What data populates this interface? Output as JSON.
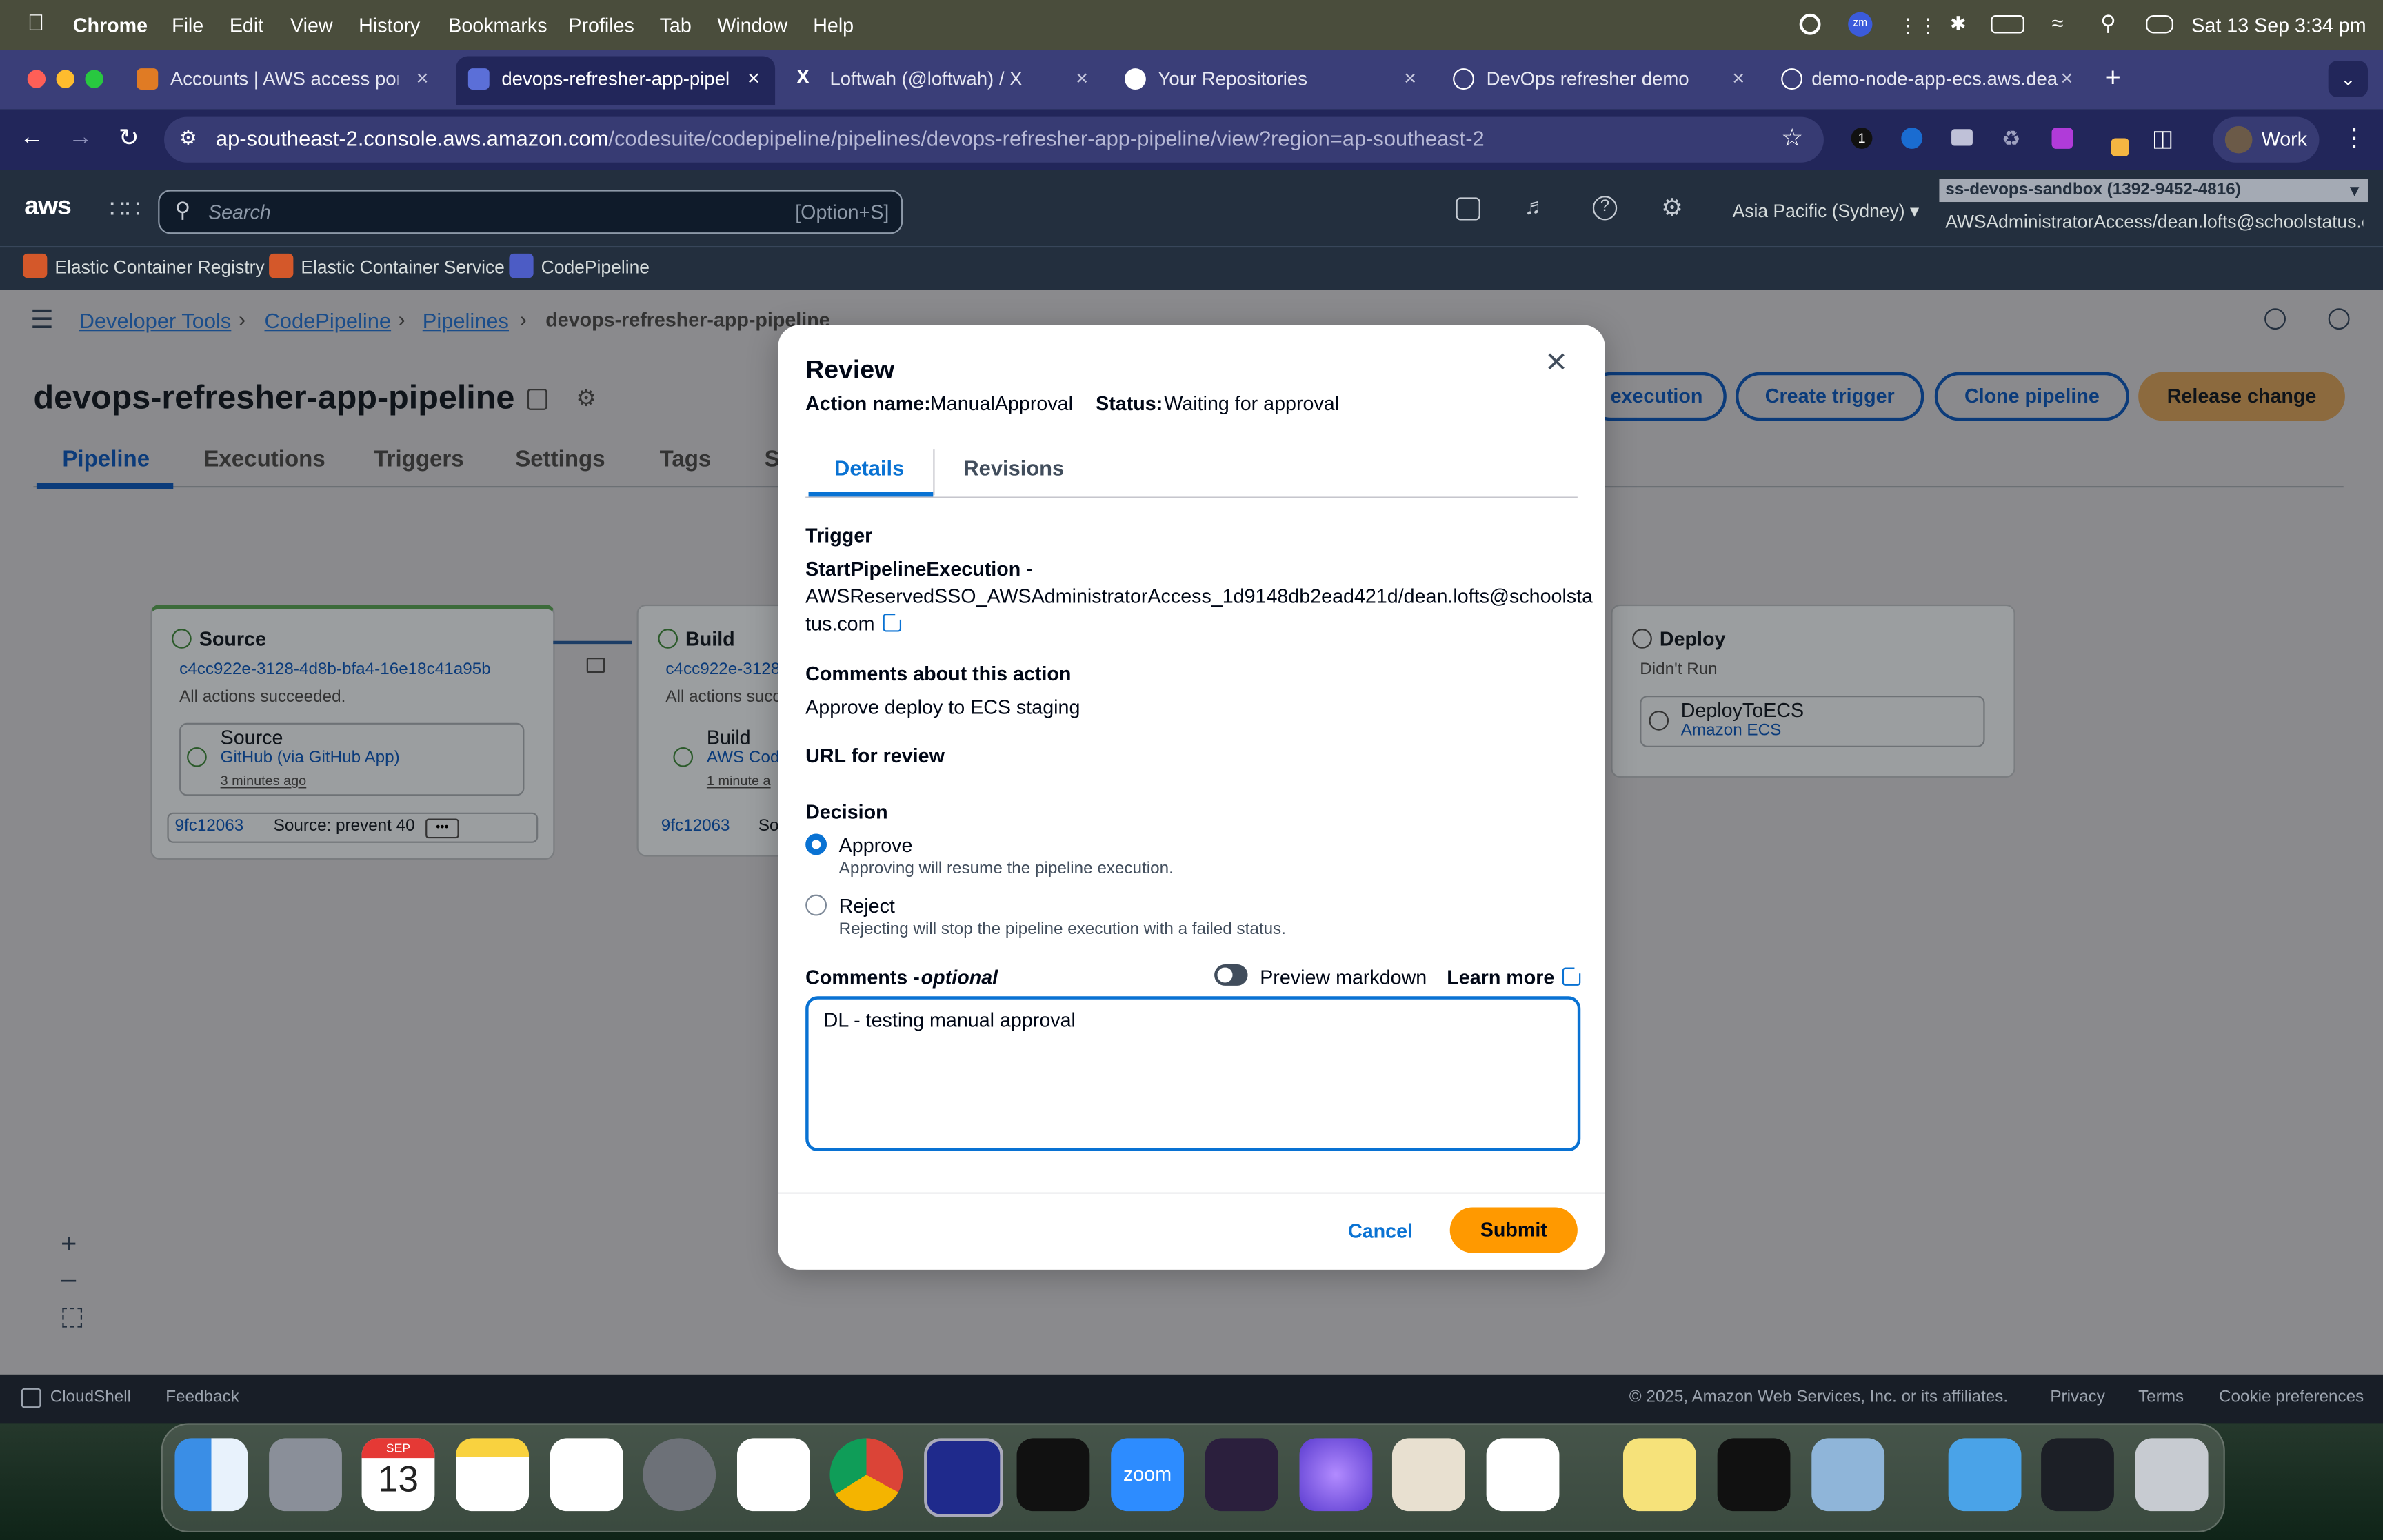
{
  "menubar": {
    "app": "Chrome",
    "items": [
      "File",
      "Edit",
      "View",
      "History",
      "Bookmarks",
      "Profiles",
      "Tab",
      "Window",
      "Help"
    ],
    "datetime": "Sat 13 Sep  3:34 pm"
  },
  "tabs": [
    {
      "title": "Accounts | AWS access porta"
    },
    {
      "title": "devops-refresher-app-pipelin"
    },
    {
      "title": "Loftwah (@loftwah) / X"
    },
    {
      "title": "Your Repositories"
    },
    {
      "title": "DevOps refresher demo"
    },
    {
      "title": "demo-node-app-ecs.aws.dea"
    }
  ],
  "address": {
    "host": "ap-southeast-2.console.aws.amazon.com",
    "path": "/codesuite/codepipeline/pipelines/devops-refresher-app-pipeline/view?region=ap-southeast-2"
  },
  "profile": "Work",
  "aws_nav": {
    "logo": "aws",
    "search_placeholder": "Search",
    "search_shortcut": "[Option+S]",
    "region": "Asia Pacific (Sydney)",
    "account": "ss-devops-sandbox (1392-9452-4816)",
    "role": "AWSAdministratorAccess/dean.lofts@schoolstatus.c..."
  },
  "favorites": [
    "Elastic Container Registry",
    "Elastic Container Service",
    "CodePipeline"
  ],
  "breadcrumb": [
    "Developer Tools",
    "CodePipeline",
    "Pipelines",
    "devops-refresher-app-pipeline"
  ],
  "page": {
    "title": "devops-refresher-app-pipeline",
    "tabs": [
      "Pipeline",
      "Executions",
      "Triggers",
      "Settings",
      "Tags",
      "S"
    ],
    "buttons": [
      "execution",
      "Create trigger",
      "Clone pipeline",
      "Release change"
    ]
  },
  "stages": {
    "source": {
      "name": "Source",
      "commit": "c4cc922e-3128-4d8b-bfa4-16e18c41a95b",
      "status": "All actions succeeded.",
      "action": "Source",
      "provider": "GitHub (via GitHub App)",
      "time": "3 minutes ago",
      "rev": "9fc12063",
      "msg": "Source: prevent 40"
    },
    "build": {
      "name": "Build",
      "commit": "c4cc922e-3128",
      "status": "All actions succ",
      "action": "Build",
      "provider": "AWS Cod",
      "time": "1 minute a",
      "rev": "9fc12063",
      "msg": "So"
    },
    "deploy": {
      "name": "Deploy",
      "status": "Didn't Run",
      "action": "DeployToECS",
      "provider": "Amazon ECS"
    }
  },
  "modal": {
    "title": "Review",
    "action_name_label": "Action name:",
    "action_name": "ManualApproval",
    "status_label": "Status:",
    "status": "Waiting for approval",
    "tabs": [
      "Details",
      "Revisions"
    ],
    "trigger_label": "Trigger",
    "trigger_type": "StartPipelineExecution -",
    "trigger_user_line1": "AWSReservedSSO_AWSAdministratorAccess_1d9148db2ead421d/dean.lofts@schoolsta",
    "trigger_user_line2": "tus.com",
    "comments_about_label": "Comments about this action",
    "comments_about": "Approve deploy to ECS staging",
    "url_review_label": "URL for review",
    "decision_label": "Decision",
    "approve_label": "Approve",
    "approve_desc": "Approving will resume the pipeline execution.",
    "reject_label": "Reject",
    "reject_desc": "Rejecting will stop the pipeline execution with a failed status.",
    "comments_label": "Comments -",
    "comments_optional": "optional",
    "preview_markdown": "Preview markdown",
    "learn_more": "Learn more",
    "comment_value": "DL - testing manual approval",
    "cancel": "Cancel",
    "submit": "Submit"
  },
  "footer": {
    "cloudshell": "CloudShell",
    "feedback": "Feedback",
    "copyright": "© 2025, Amazon Web Services, Inc. or its affiliates.",
    "privacy": "Privacy",
    "terms": "Terms",
    "cookies": "Cookie preferences"
  },
  "dock_calendar": {
    "month": "SEP",
    "day": "13"
  },
  "dock_zoom": "zoom"
}
